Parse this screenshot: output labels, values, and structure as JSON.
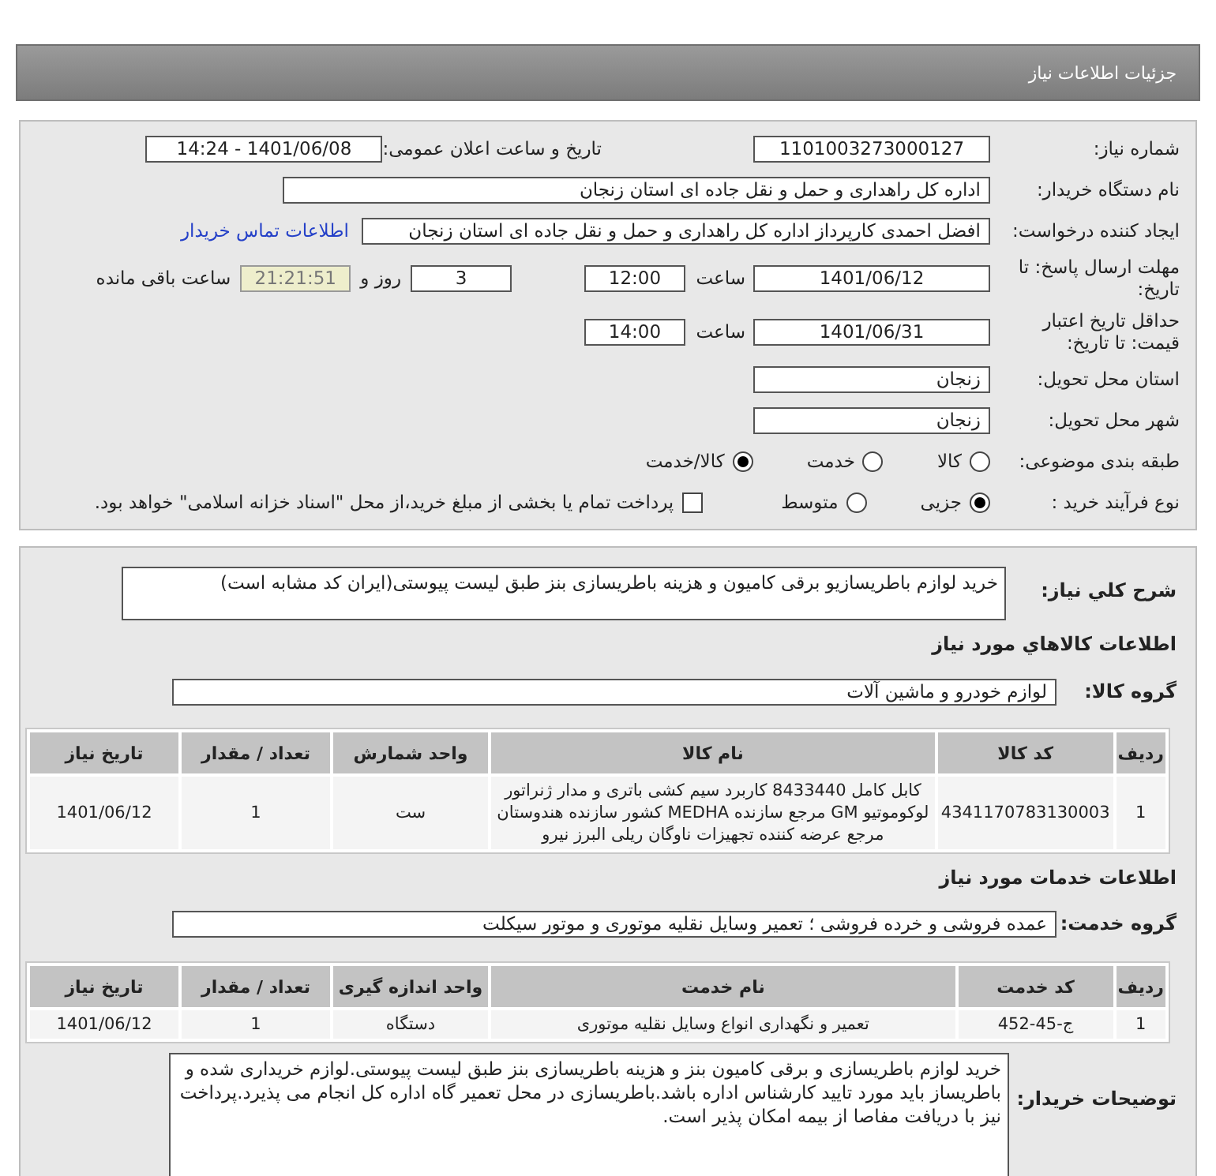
{
  "header": {
    "title": "جزئیات اطلاعات نیاز"
  },
  "need_number": {
    "label": "شماره نیاز:",
    "value": "1101003273000127"
  },
  "announce": {
    "label": "تاریخ و ساعت اعلان عمومی:",
    "value": "1401/06/08 - 14:24"
  },
  "buyer_org": {
    "label": "نام دستگاه خریدار:",
    "value": "اداره کل راهداری و حمل و نقل جاده ای استان زنجان"
  },
  "requester": {
    "label": "ایجاد کننده درخواست:",
    "value": "افضل احمدی کارپرداز اداره کل راهداری و حمل و نقل جاده ای استان زنجان",
    "link": "اطلاعات تماس خریدار"
  },
  "deadline": {
    "label": "مهلت ارسال پاسخ: تا تاریخ:",
    "date": "1401/06/12",
    "time_label": "ساعت",
    "time": "12:00",
    "days": "3",
    "days_label": "روز و",
    "remaining": "21:21:51",
    "remaining_label": "ساعت باقی مانده"
  },
  "validity": {
    "label": "حداقل تاریخ اعتبار قیمت: تا تاریخ:",
    "date": "1401/06/31",
    "time_label": "ساعت",
    "time": "14:00"
  },
  "province": {
    "label": "استان محل تحویل:",
    "value": "زنجان"
  },
  "city": {
    "label": "شهر محل تحویل:",
    "value": "زنجان"
  },
  "category": {
    "label": "طبقه بندی موضوعی:",
    "options": [
      {
        "label": "کالا",
        "selected": false
      },
      {
        "label": "خدمت",
        "selected": false
      },
      {
        "label": "کالا/خدمت",
        "selected": true
      }
    ]
  },
  "process": {
    "label": "نوع فرآیند خرید :",
    "options": [
      {
        "label": "جزیی",
        "selected": true
      },
      {
        "label": "متوسط",
        "selected": false
      }
    ],
    "payment": {
      "label": "پرداخت تمام یا بخشی از مبلغ خرید،از محل \"اسناد خزانه اسلامی\" خواهد بود.",
      "checked": false
    }
  },
  "summary": {
    "label": "شرح کلي نياز:",
    "value": "خرید لوازم باطریسازیو برقی کامیون و هزینه باطریسازی بنز طبق لیست پیوستی(ایران کد مشابه است)"
  },
  "goods": {
    "heading": "اطلاعات کالاهاي مورد نياز",
    "group_label": "گروه کالا:",
    "group": "لوازم خودرو و ماشین آلات",
    "columns": [
      "ردیف",
      "کد کالا",
      "نام کالا",
      "واحد شمارش",
      "تعداد / مقدار",
      "تاریخ نیاز"
    ],
    "rows": [
      [
        "1",
        "4341170783130003",
        "کابل کامل 8433440 کاربرد سیم کشی باتری و مدار ژنراتور لوکوموتیو GM مرجع سازنده MEDHA کشور سازنده هندوستان مرجع عرضه کننده تجهیزات ناوگان ریلی البرز نیرو",
        "ست",
        "1",
        "1401/06/12"
      ]
    ]
  },
  "services": {
    "heading": "اطلاعات خدمات مورد نیاز",
    "group_label": "گروه خدمت:",
    "group": "عمده فروشی و خرده فروشی ؛ تعمیر وسایل نقلیه موتوری و موتور سیکلت",
    "columns": [
      "ردیف",
      "کد خدمت",
      "نام خدمت",
      "واحد اندازه گیری",
      "تعداد / مقدار",
      "تاریخ نیاز"
    ],
    "rows": [
      [
        "1",
        "ج-45-452",
        "تعمیر و نگهداری انواع وسایل نقلیه موتوری",
        "دستگاه",
        "1",
        "1401/06/12"
      ]
    ]
  },
  "buyer_notes": {
    "label": "توضیحات خریدار:",
    "value": "خرید لوازم باطریسازی و برقی کامیون بنز و هزینه باطریسازی بنز طبق لیست پیوستی.لوازم خریداری شده و باطریساز باید مورد تایید کارشناس اداره باشد.باطریسازی در محل تعمیر گاه اداره کل انجام می پذیرد.پرداخت نیز با دریافت مفاصا از بیمه امکان پذیر است."
  }
}
